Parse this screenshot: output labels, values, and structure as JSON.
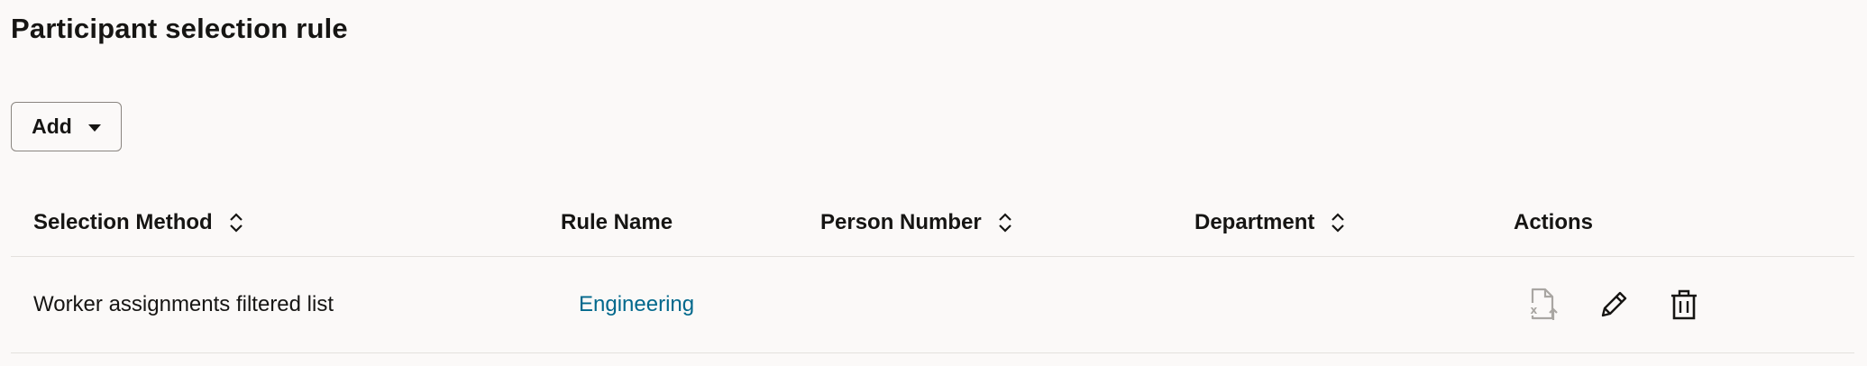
{
  "page": {
    "title": "Participant selection rule"
  },
  "toolbar": {
    "add_label": "Add"
  },
  "table": {
    "columns": [
      {
        "label": "Selection Method",
        "sortable": true
      },
      {
        "label": "Rule Name",
        "sortable": false
      },
      {
        "label": "Person Number",
        "sortable": true
      },
      {
        "label": "Department",
        "sortable": true
      },
      {
        "label": "Actions",
        "sortable": false
      }
    ],
    "rows": [
      {
        "selection_method": "Worker assignments filtered list",
        "rule_name": "Engineering",
        "person_number": "",
        "department": ""
      }
    ]
  },
  "icons": {
    "sort": "sort-updown-icon",
    "export": "excel-export-icon",
    "edit": "pencil-icon",
    "delete": "trash-icon",
    "dropdown": "caret-down-icon"
  },
  "colors": {
    "link": "#00688c",
    "text": "#161513",
    "background": "#fbf9f8",
    "disabled_icon": "#a9a6a2"
  }
}
